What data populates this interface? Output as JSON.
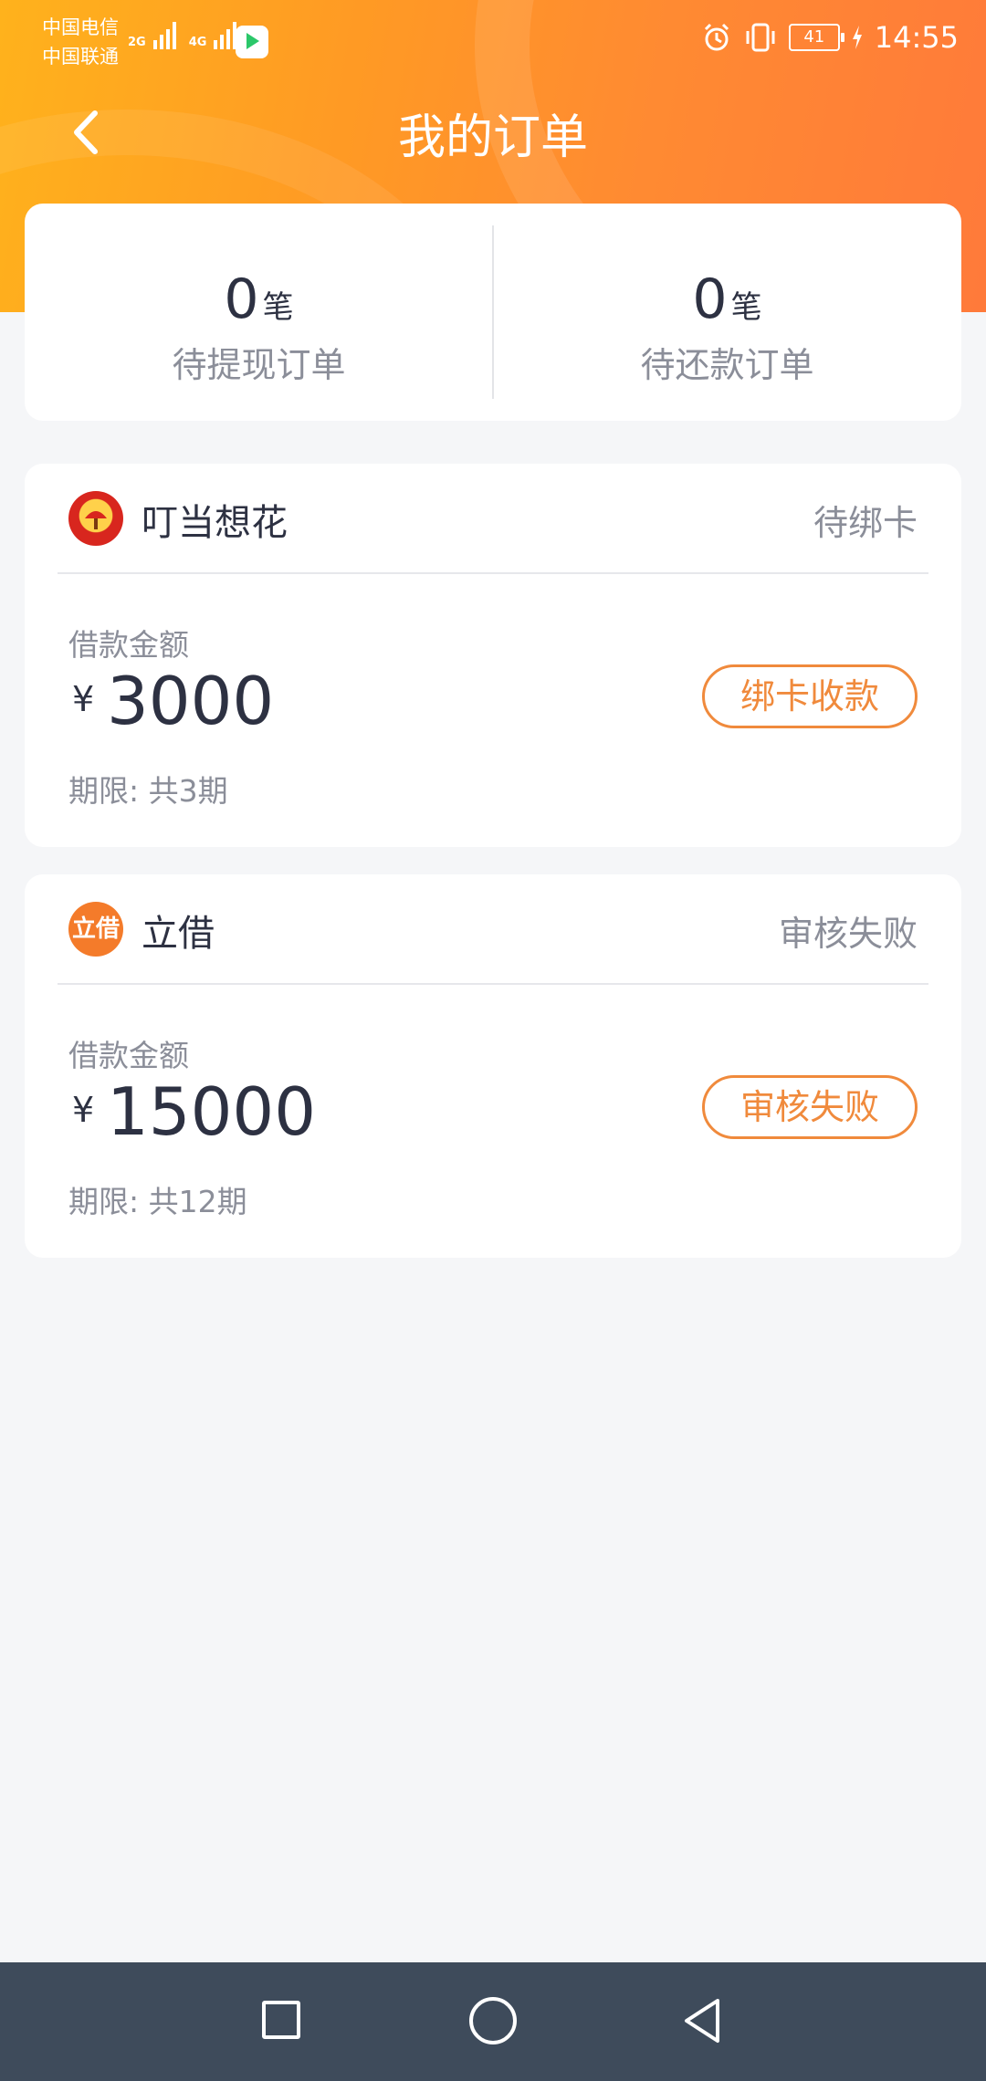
{
  "status_bar": {
    "carrier1": "中国电信",
    "carrier2": "中国联通",
    "sig1_label": "2G",
    "sig2_label": "4G",
    "battery": "41",
    "time": "14:55"
  },
  "header": {
    "title": "我的订单",
    "back_icon": "back-arrow-icon"
  },
  "summary": [
    {
      "count": "0",
      "unit": "笔",
      "label": "待提现订单"
    },
    {
      "count": "0",
      "unit": "笔",
      "label": "待还款订单"
    }
  ],
  "orders": [
    {
      "lender": "叮当想花",
      "status": "待绑卡",
      "amount_label": "借款金额",
      "currency": "¥",
      "amount": "3000",
      "term": "期限: 共3期",
      "action": "绑卡收款"
    },
    {
      "lender": "立借",
      "logo_text": "立借",
      "status": "审核失败",
      "amount_label": "借款金额",
      "currency": "¥",
      "amount": "15000",
      "term": "期限: 共12期",
      "action": "审核失败"
    }
  ],
  "colors": {
    "accent": "#f08a3c",
    "header_start": "#ffb21c",
    "header_end": "#ff7a3a",
    "nav_bar": "#3e4b5b"
  }
}
